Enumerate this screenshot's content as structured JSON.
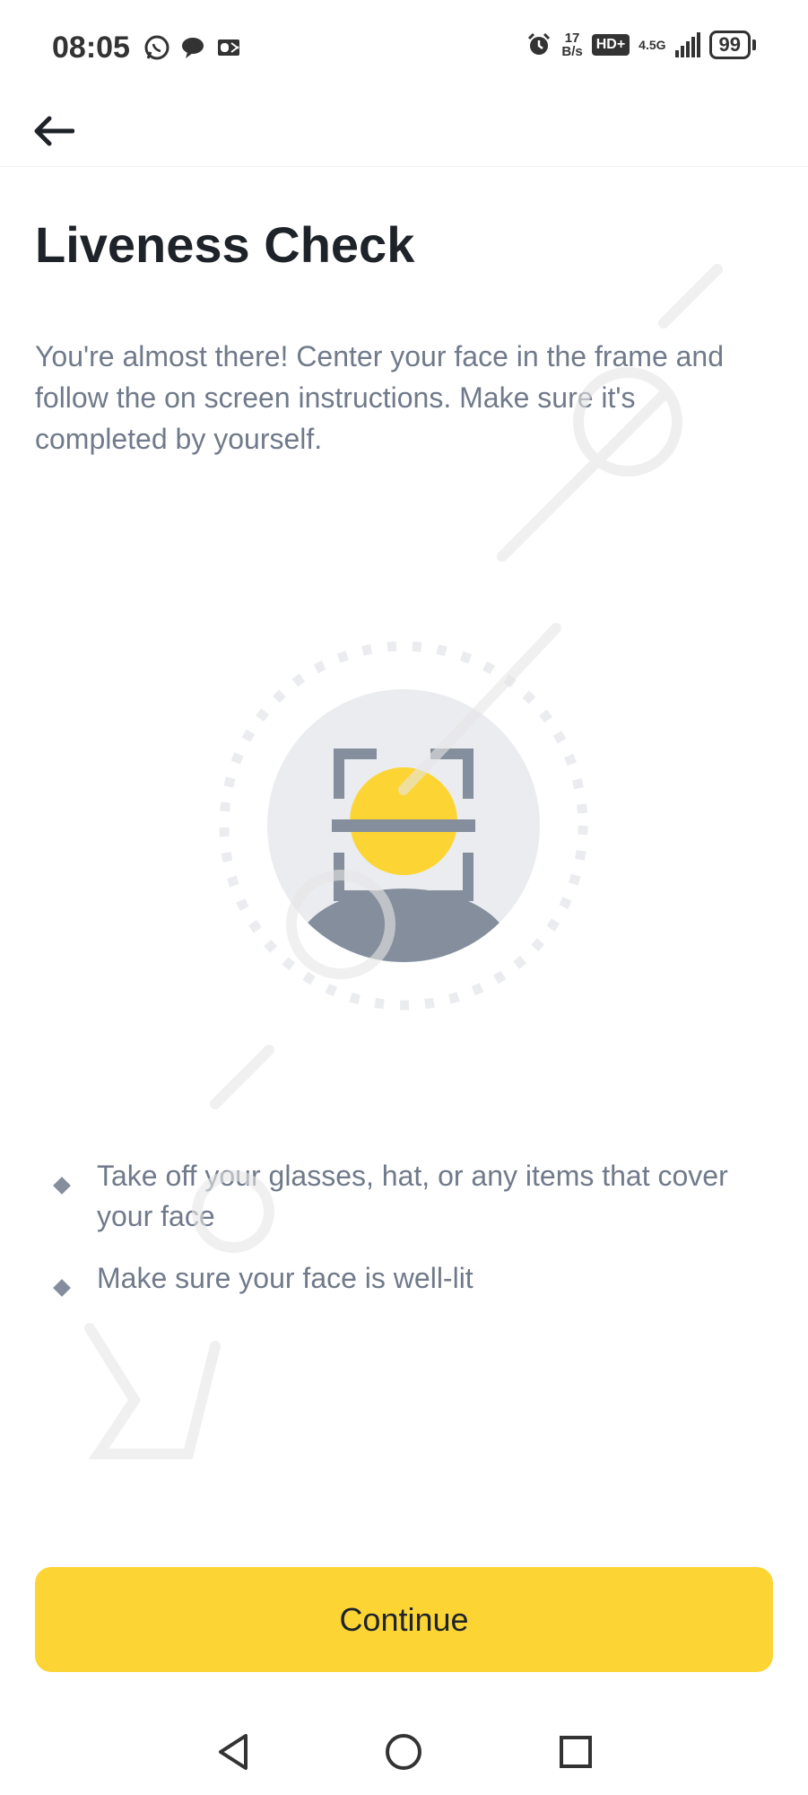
{
  "status_bar": {
    "time": "08:05",
    "net_speed_value": "17",
    "net_speed_unit": "B/s",
    "hd_label": "HD+",
    "net_type": "4.5G",
    "battery": "99",
    "left_icons": [
      "whatsapp-icon",
      "chat-bubble-icon",
      "outlook-icon"
    ],
    "right_icons": [
      "alarm-icon",
      "signal-icon",
      "battery-icon"
    ]
  },
  "header": {
    "back_icon": "arrow-left-icon"
  },
  "page": {
    "title": "Liveness Check",
    "description": "You're almost there! Center your face in the frame and follow the on screen instructions. Make sure it's completed by yourself."
  },
  "illustration": {
    "icon": "face-scan-icon",
    "accent_color": "#FCD535",
    "frame_color": "#848E9C",
    "circle_color": "#EAECEF"
  },
  "tips": [
    "Take off your glasses, hat, or any items that cover your face",
    "Make sure your face is well-lit"
  ],
  "actions": {
    "continue_label": "Continue"
  },
  "nav_bar": {
    "icons": [
      "back-triangle-icon",
      "home-circle-icon",
      "recents-square-icon"
    ]
  },
  "colors": {
    "brand_yellow": "#FCD535",
    "text_primary": "#1E2329",
    "text_secondary": "#707A8A"
  }
}
